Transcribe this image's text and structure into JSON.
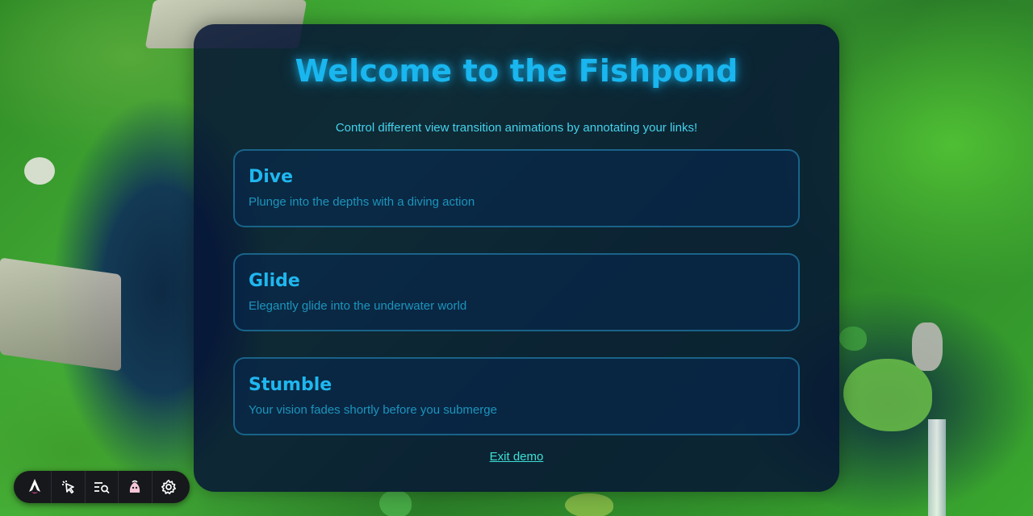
{
  "page": {
    "title": "Welcome to the Fishpond",
    "subtitle": "Control different view transition animations by annotating your links!"
  },
  "cards": [
    {
      "title": "Dive",
      "description": "Plunge into the depths with a diving action"
    },
    {
      "title": "Glide",
      "description": "Elegantly glide into the underwater world"
    },
    {
      "title": "Stumble",
      "description": "Your vision fades shortly before you submerge"
    }
  ],
  "exit_link": "Exit demo",
  "toolbar": {
    "items": [
      "astro-logo-icon",
      "inspect-cursor-icon",
      "audit-search-icon",
      "accessibility-icon",
      "settings-gear-icon"
    ]
  },
  "colors": {
    "accent": "#19b6ef",
    "subtitle": "#45d2ec",
    "exit_link": "#3ee0d6",
    "panel_bg": "#061434"
  }
}
